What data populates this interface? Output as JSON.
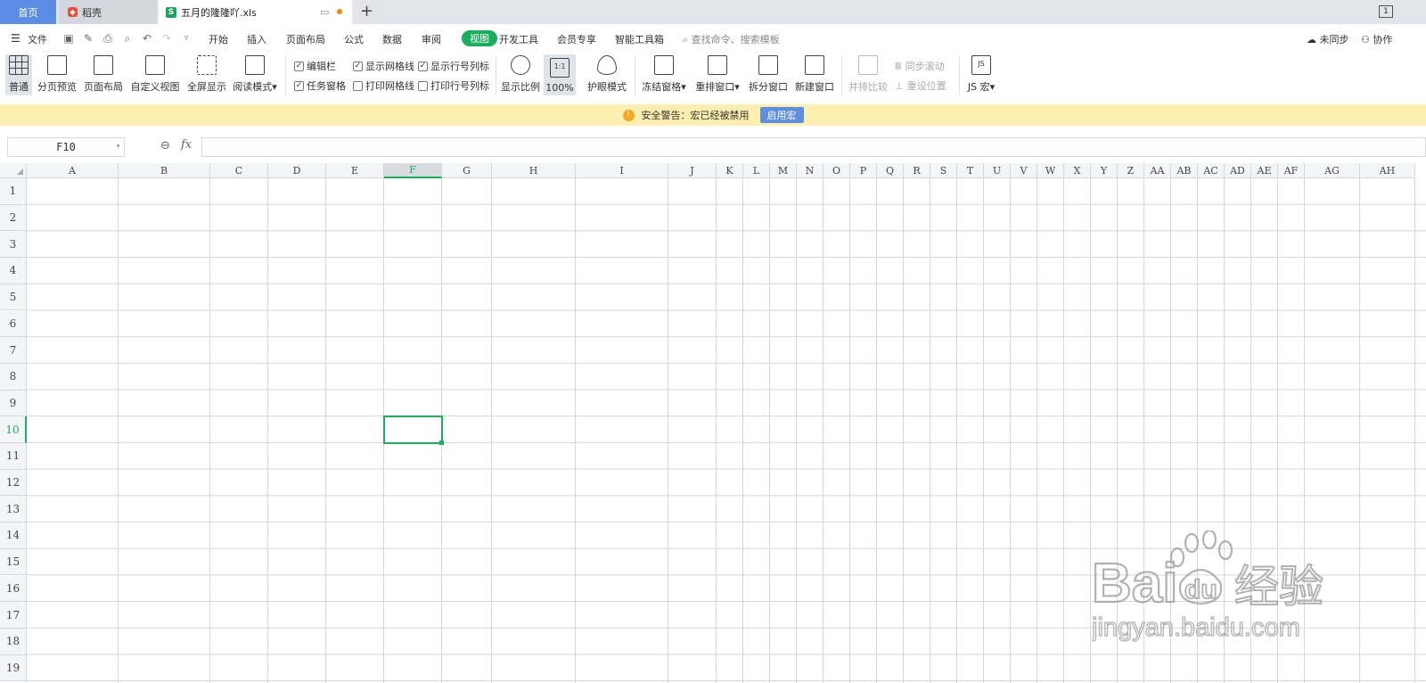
{
  "tabs": {
    "home": "首页",
    "docer": "稻壳",
    "file": "五月的隆隆吖.xls",
    "window_count": "1"
  },
  "menu": {
    "file": "文件",
    "items": [
      "开始",
      "插入",
      "页面布局",
      "公式",
      "数据",
      "审阅",
      "视图",
      "开发工具",
      "会员专享",
      "智能工具箱"
    ],
    "active_index": 6,
    "search": "查找命令、搜索模板",
    "sync": "未同步",
    "collab": "协作"
  },
  "ribbon": {
    "buttons": [
      "普通",
      "分页预览",
      "页面布局",
      "自定义视图",
      "全屏显示",
      "阅读模式"
    ],
    "checks": [
      {
        "label": "编辑栏",
        "checked": true
      },
      {
        "label": "任务窗格",
        "checked": true
      },
      {
        "label": "显示网格线",
        "checked": true
      },
      {
        "label": "打印网格线",
        "checked": false
      },
      {
        "label": "显示行号列标",
        "checked": true
      },
      {
        "label": "打印行号列标",
        "checked": false
      }
    ],
    "zoom": [
      "显示比例",
      "100%"
    ],
    "eye": "护眼模式",
    "window": [
      "冻结窗格",
      "重排窗口",
      "拆分窗口",
      "新建窗口"
    ],
    "compare": {
      "side_by_side": "并排比较",
      "sync_scroll": "同步滚动",
      "reset_pos": "重设位置"
    },
    "macro": "JS 宏"
  },
  "warning": {
    "text": "安全警告：宏已经被禁用",
    "button": "启用宏"
  },
  "formula": {
    "namebox": "F10",
    "fx": "fx",
    "value": ""
  },
  "sheet": {
    "columns": [
      "A",
      "B",
      "C",
      "D",
      "E",
      "F",
      "G",
      "H",
      "I",
      "J",
      "K",
      "L",
      "M",
      "N",
      "O",
      "P",
      "Q",
      "R",
      "S",
      "T",
      "U",
      "V",
      "W",
      "X",
      "Y",
      "Z",
      "AA",
      "AB",
      "AC",
      "AD",
      "AE",
      "AF",
      "AG",
      "AH"
    ],
    "rows": [
      "1",
      "2",
      "3",
      "4",
      "5",
      "6",
      "7",
      "8",
      "9",
      "10",
      "11",
      "12",
      "13",
      "14",
      "15",
      "16",
      "17",
      "18",
      "19"
    ],
    "active_col": "F",
    "active_row": "10"
  },
  "watermark": {
    "brand": "Bai",
    "du": "du",
    "jy": "经验",
    "url": "jingyan.baidu.com"
  }
}
